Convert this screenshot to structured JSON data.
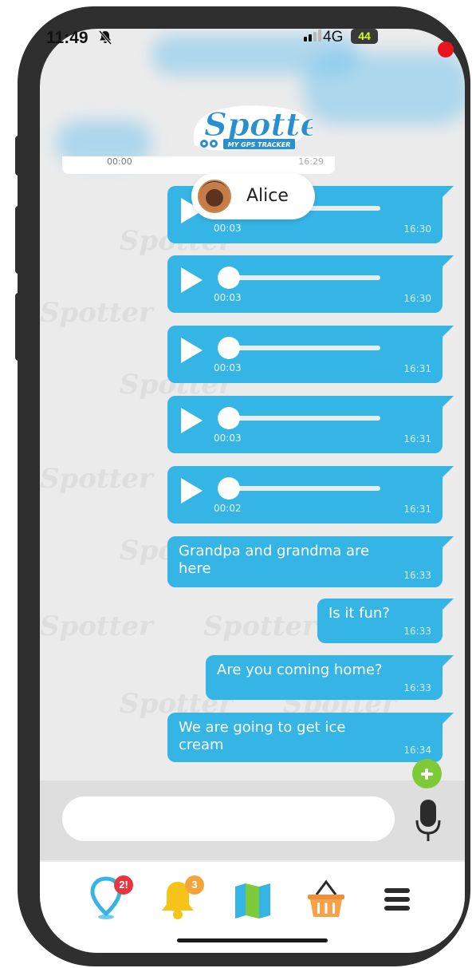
{
  "status_bar": {
    "time": "11:49",
    "network": "4G",
    "battery": "44"
  },
  "brand": {
    "name": "Spotter",
    "tagline": "MY GPS TRACKER",
    "watermark_text": "Spotter"
  },
  "top_card": {
    "duration": "00:00",
    "time": "16:29"
  },
  "contact": {
    "name": "Alice"
  },
  "messages": [
    {
      "type": "voice",
      "duration": "00:03",
      "time": "16:30",
      "progress": 0
    },
    {
      "type": "voice",
      "duration": "00:03",
      "time": "16:30",
      "progress": 0
    },
    {
      "type": "voice",
      "duration": "00:03",
      "time": "16:31",
      "progress": 0
    },
    {
      "type": "voice",
      "duration": "00:03",
      "time": "16:31",
      "progress": 0
    },
    {
      "type": "voice",
      "duration": "00:02",
      "time": "16:31",
      "progress": 0
    },
    {
      "type": "text",
      "line1": "Grandpa and grandma are",
      "line2": "here",
      "time": "16:33"
    },
    {
      "type": "text",
      "line1": "Is it fun?",
      "time": "16:33"
    },
    {
      "type": "text",
      "line1": "Are you coming home?",
      "time": "16:33"
    },
    {
      "type": "text",
      "line1": "We are going to get ice",
      "line2": "cream",
      "time": "16:34"
    }
  ],
  "composer": {
    "value": "",
    "placeholder": ""
  },
  "nav": {
    "location_badge": "2!",
    "alerts_badge": "3"
  },
  "colors": {
    "bubble": "#35b4e6",
    "accent_green": "#7ecb3a",
    "badge_red": "#e8363f",
    "badge_orange": "#f3a53b",
    "bell_yellow": "#f6c419"
  },
  "icons": [
    "bell-off-icon",
    "signal-icon",
    "play-icon",
    "plus-icon",
    "microphone-icon",
    "location-pin-icon",
    "bell-icon",
    "map-icon",
    "basket-icon",
    "menu-icon"
  ]
}
